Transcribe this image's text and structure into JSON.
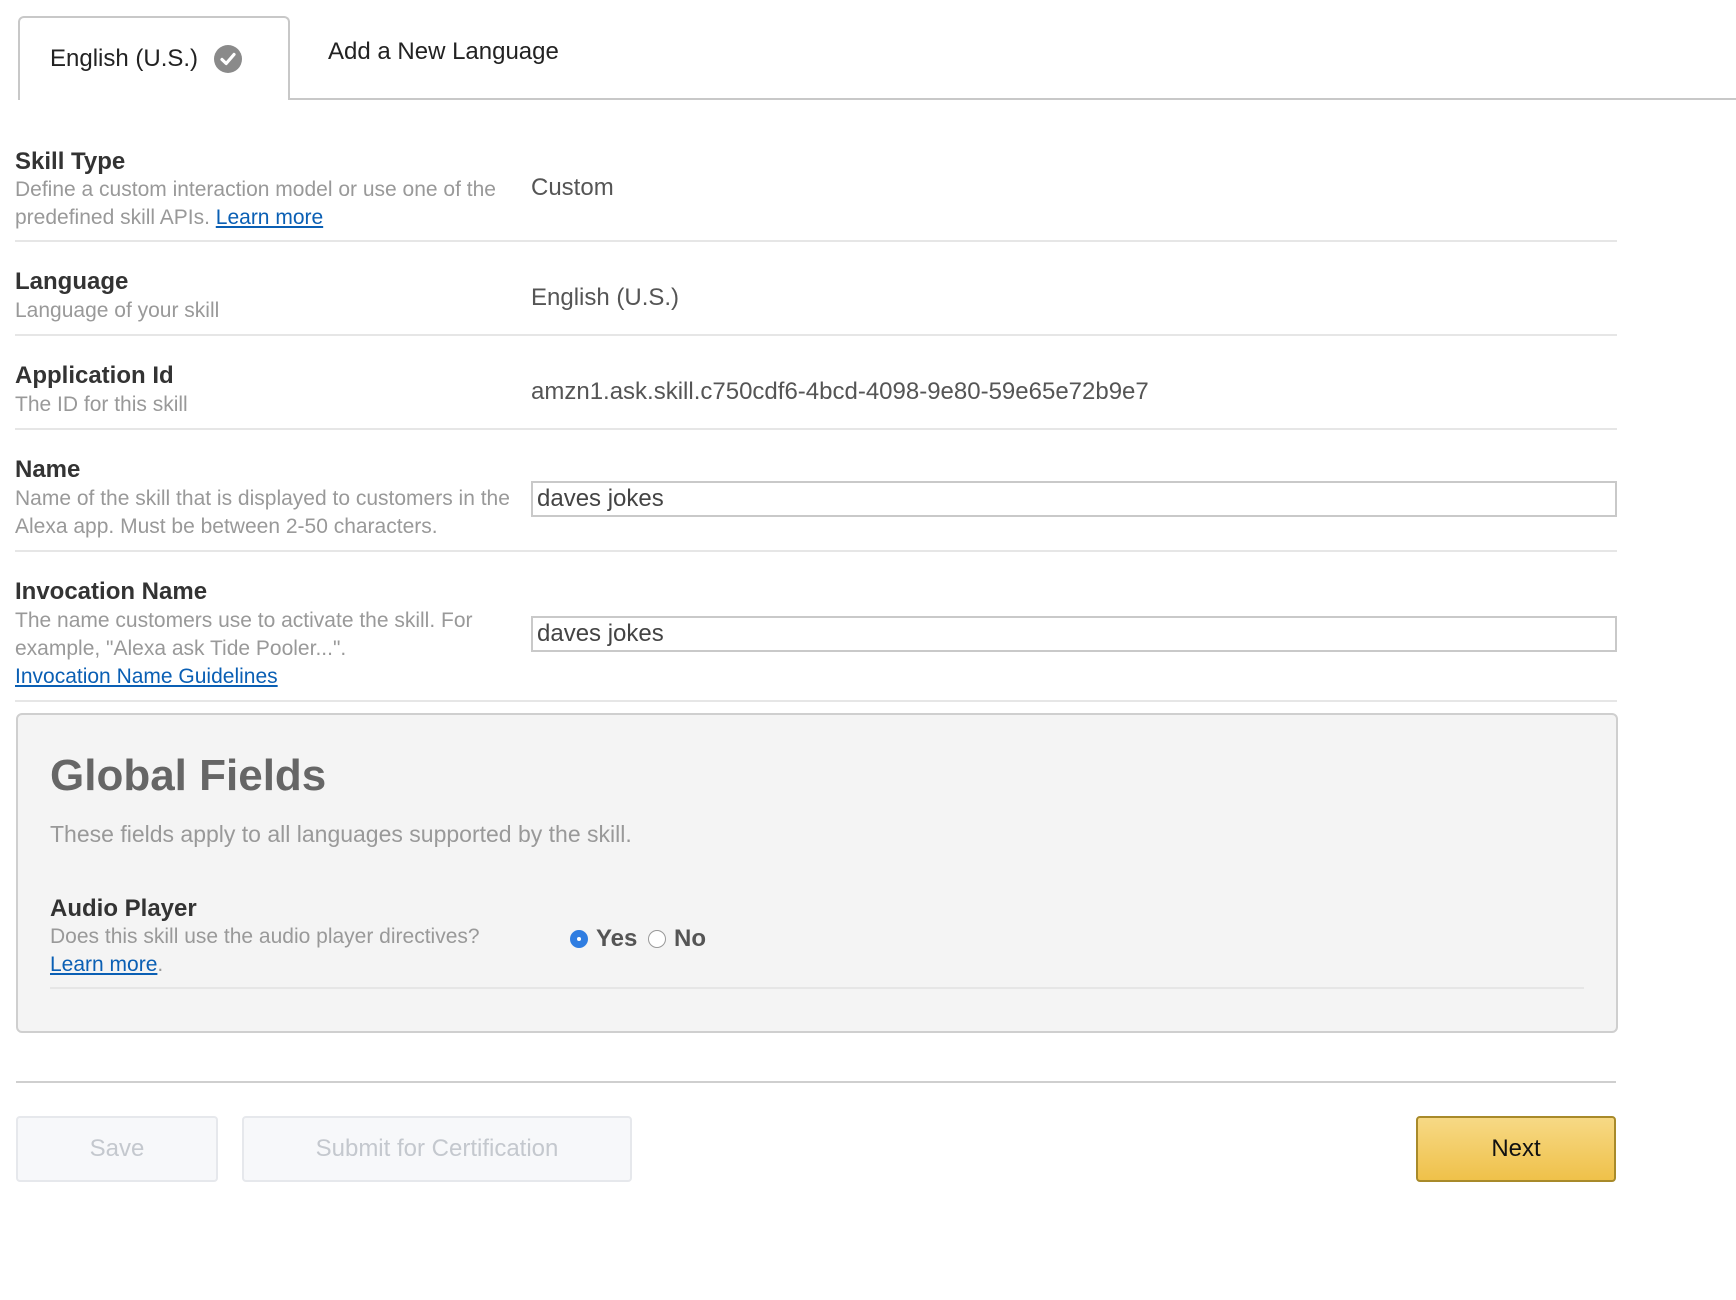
{
  "tabs": {
    "active_label": "English (U.S.)",
    "add_label": "Add a New Language"
  },
  "skill_type": {
    "label": "Skill Type",
    "desc": "Define a custom interaction model or use one of the predefined skill APIs.",
    "link": "Learn more",
    "value": "Custom"
  },
  "language": {
    "label": "Language",
    "desc": "Language of your skill",
    "value": "English (U.S.)"
  },
  "application_id": {
    "label": "Application Id",
    "desc": "The ID for this skill",
    "value": "amzn1.ask.skill.c750cdf6-4bcd-4098-9e80-59e65e72b9e7"
  },
  "name": {
    "label": "Name",
    "desc": "Name of the skill that is displayed to customers in the Alexa app. Must be between 2-50 characters.",
    "value": "daves jokes"
  },
  "invocation_name": {
    "label": "Invocation Name",
    "desc": "The name customers use to activate the skill. For example, \"Alexa ask Tide Pooler...\".",
    "link": "Invocation Name Guidelines",
    "value": "daves jokes"
  },
  "global_fields": {
    "title": "Global Fields",
    "subtitle": "These fields apply to all languages supported by the skill.",
    "audio_player": {
      "label": "Audio Player",
      "desc": "Does this skill use the audio player directives?",
      "link": "Learn more",
      "link_suffix": ".",
      "yes_label": "Yes",
      "no_label": "No",
      "selected": "Yes"
    }
  },
  "buttons": {
    "save": "Save",
    "submit": "Submit for Certification",
    "next": "Next"
  },
  "colors": {
    "link": "#0a5fb4",
    "radio_selected": "#2f7de1",
    "next_button": "#efc14a"
  }
}
